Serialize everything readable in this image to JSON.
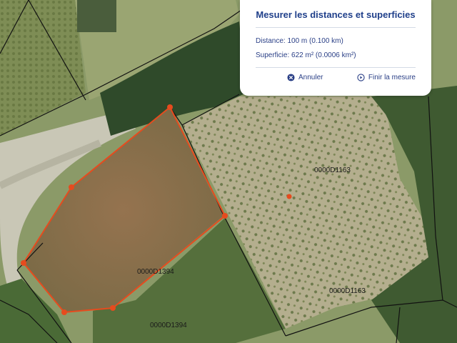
{
  "panel": {
    "title": "Mesurer les distances et superficies",
    "distance_label": "Distance:",
    "distance_value": "100 m (0.100 km)",
    "area_label": "Superficie:",
    "area_value": "622 m² (0.0006 km²)",
    "cancel_label": "Annuler",
    "cancel_icon": "close-circle-icon",
    "finish_label": "Finir la mesure",
    "finish_icon": "play-circle-icon"
  },
  "parcels": [
    {
      "id": "0000D1163"
    },
    {
      "id": "0000D1394"
    },
    {
      "id": "0000D1163"
    },
    {
      "id": "0000D1394"
    }
  ],
  "measure": {
    "color": "#e64b1e"
  }
}
